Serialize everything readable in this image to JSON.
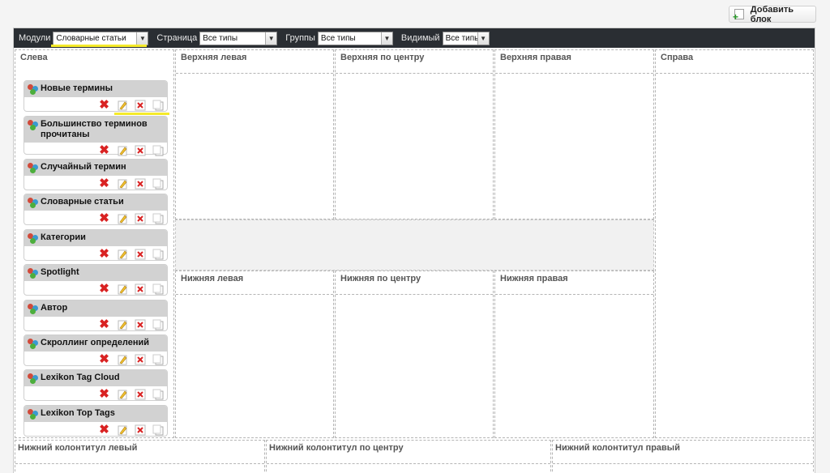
{
  "add_button": {
    "label": "Добавить блок",
    "icon": "add-document-icon"
  },
  "toolbar": {
    "modules_label": "Модули",
    "modules_value": "Словарные статьи",
    "page_label": "Страница",
    "page_value": "Все типы",
    "groups_label": "Группы",
    "groups_value": "Все типы",
    "visible_label": "Видимый",
    "visible_value": "Все типы"
  },
  "positions": {
    "left": "Слева",
    "top_left": "Верхняя левая",
    "top_center": "Верхняя по центру",
    "top_right": "Верхняя правая",
    "right": "Справа",
    "bottom_left": "Нижняя левая",
    "bottom_center": "Нижняя по центру",
    "bottom_right": "Нижняя правая",
    "footer_left": "Нижний колонтитул левый",
    "footer_center": "Нижний колонтитул по центру",
    "footer_right": "Нижний колонтитул правый"
  },
  "modules": [
    {
      "title": "Новые термины"
    },
    {
      "title": "Большинство терминов прочитаны"
    },
    {
      "title": "Случайный термин"
    },
    {
      "title": "Словарные статьи"
    },
    {
      "title": "Категории"
    },
    {
      "title": "Spotlight"
    },
    {
      "title": "Автор"
    },
    {
      "title": "Скроллинг определений"
    },
    {
      "title": "Lexikon Tag Cloud"
    },
    {
      "title": "Lexikon Top Tags"
    }
  ],
  "module_actions": [
    "delete-icon",
    "edit-icon",
    "disable-icon",
    "copy-icon"
  ],
  "colors": {
    "toolbar_bg": "#2a2e33",
    "highlight": "#f5ea2a",
    "delete": "#d92222"
  }
}
